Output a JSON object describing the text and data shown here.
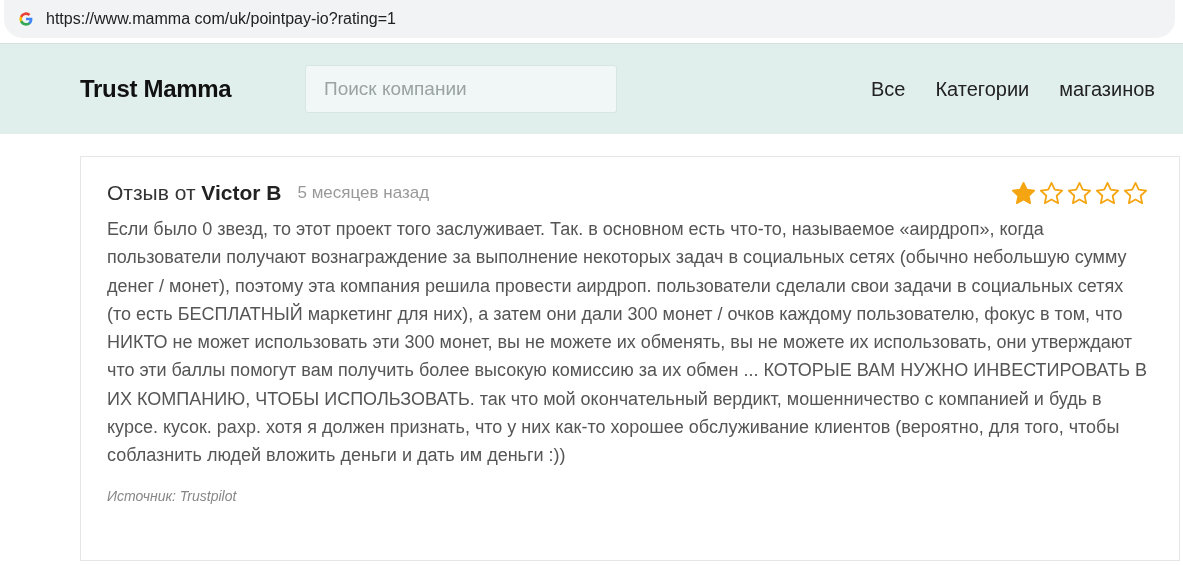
{
  "address_bar": {
    "url": "https://www.mamma com/uk/pointpay-io?rating=1"
  },
  "header": {
    "logo": "Trust Mamma",
    "search": {
      "placeholder": "Поиск компании"
    },
    "nav": [
      "Все",
      "Категории",
      "магазинов"
    ]
  },
  "review": {
    "title": "Отзыв от **Victor B**",
    "date": "5 месяцев назад",
    "stars": 1,
    "body": "Если было 0 звезд, то этот проект того заслуживает. Так. в основном есть что-то, называемое «аирдроп», когда пользователи получают вознаграждение за выполнение некоторых задач в социальных сетях (обычно небольшую сумму денег / монет), поэтому эта компания решила провести аирдроп. пользователи сделали свои задачи в социальных сетях (то есть БЕСПЛАТНЫЙ маркетинг для них), а затем они дали 300 монет / очков каждому пользователю, фокус в том, что НИКТО не может использовать эти 300 монет, вы не можете их обменять, вы не можете их использовать, они утверждают что эти баллы помогут вам получить более высокую комиссию за их обмен ... КОТОРЫЕ ВАМ НУЖНО ИНВЕСТИРОВАТЬ В ИХ КОМПАНИЮ, ЧТОБЫ ИСПОЛЬЗОВАТЬ. так что мой окончательный вердикт, мошенничество с компанией и будь в курсе. кусок. рахр. хотя я должен признать, что у них как-то хорошее обслуживание клиентов (вероятно, для того, чтобы соблазнить людей вложить деньги и дать им деньги :))",
    "source": "Источник: Trustpilot"
  }
}
